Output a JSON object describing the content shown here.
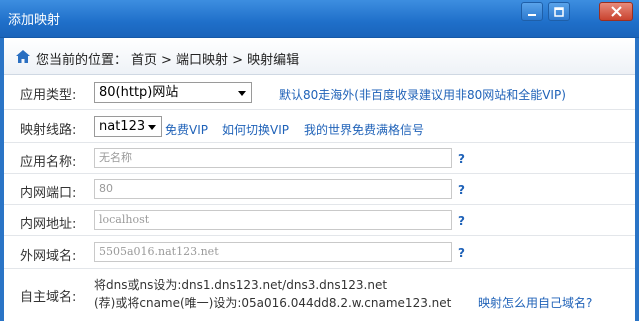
{
  "window": {
    "title": "添加映射"
  },
  "breadcrumb": {
    "prefix": "您当前的位置：",
    "items": [
      "首页",
      "> 端口映射",
      "> 映射编辑"
    ]
  },
  "form": {
    "app_type": {
      "label": "应用类型:",
      "value": "80(http)网站",
      "hint": "默认80走海外(非百度收录建议用非80网站和全能VIP)"
    },
    "route": {
      "label": "映射线路:",
      "value": "nat123",
      "links": [
        "免费VIP",
        "如何切换VIP",
        "我的世界免费满格信号"
      ]
    },
    "app_name": {
      "label": "应用名称:",
      "placeholder": "无名称"
    },
    "lan_port": {
      "label": "内网端口:",
      "value": "80"
    },
    "lan_addr": {
      "label": "内网地址:",
      "value": "localhost"
    },
    "wan_domain": {
      "label": "外网域名:",
      "value": "5505a016.nat123.net"
    },
    "own_domain": {
      "label": "自主域名:",
      "line1": "将dns或ns设为:dns1.dns123.net/dns3.dns123.net",
      "line2": "(荐)或将cname(唯一)设为:05a016.044dd8.2.w.cname123.net",
      "link": "映射怎么用自己域名?"
    },
    "help_glyph": "?"
  }
}
